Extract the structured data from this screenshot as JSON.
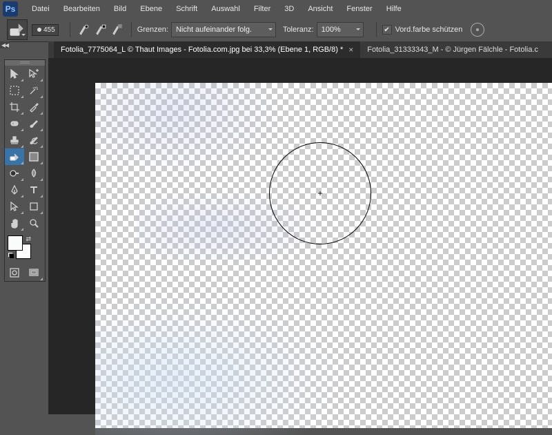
{
  "app": {
    "logo_text": "Ps"
  },
  "menu": [
    "Datei",
    "Bearbeiten",
    "Bild",
    "Ebene",
    "Schrift",
    "Auswahl",
    "Filter",
    "3D",
    "Ansicht",
    "Fenster",
    "Hilfe"
  ],
  "options": {
    "brush_size": "455",
    "limits_label": "Grenzen:",
    "limits_value": "Nicht aufeinander folg.",
    "tolerance_label": "Toleranz:",
    "tolerance_value": "100%",
    "protect_fg_label": "Vord.farbe schützen",
    "protect_fg_checked": "✔"
  },
  "tabs": [
    {
      "label": "Fotolia_7775064_L © Thaut Images - Fotolia.com.jpg bei 33,3% (Ebene 1, RGB/8) *",
      "active": true
    },
    {
      "label": "Fotolia_31333343_M - © Jürgen Fälchle - Fotolia.c",
      "active": false
    }
  ],
  "collapse_marks": "◀◀",
  "tools": {
    "fg_color": "#fafbfb",
    "bg_color": "#ffffff"
  }
}
